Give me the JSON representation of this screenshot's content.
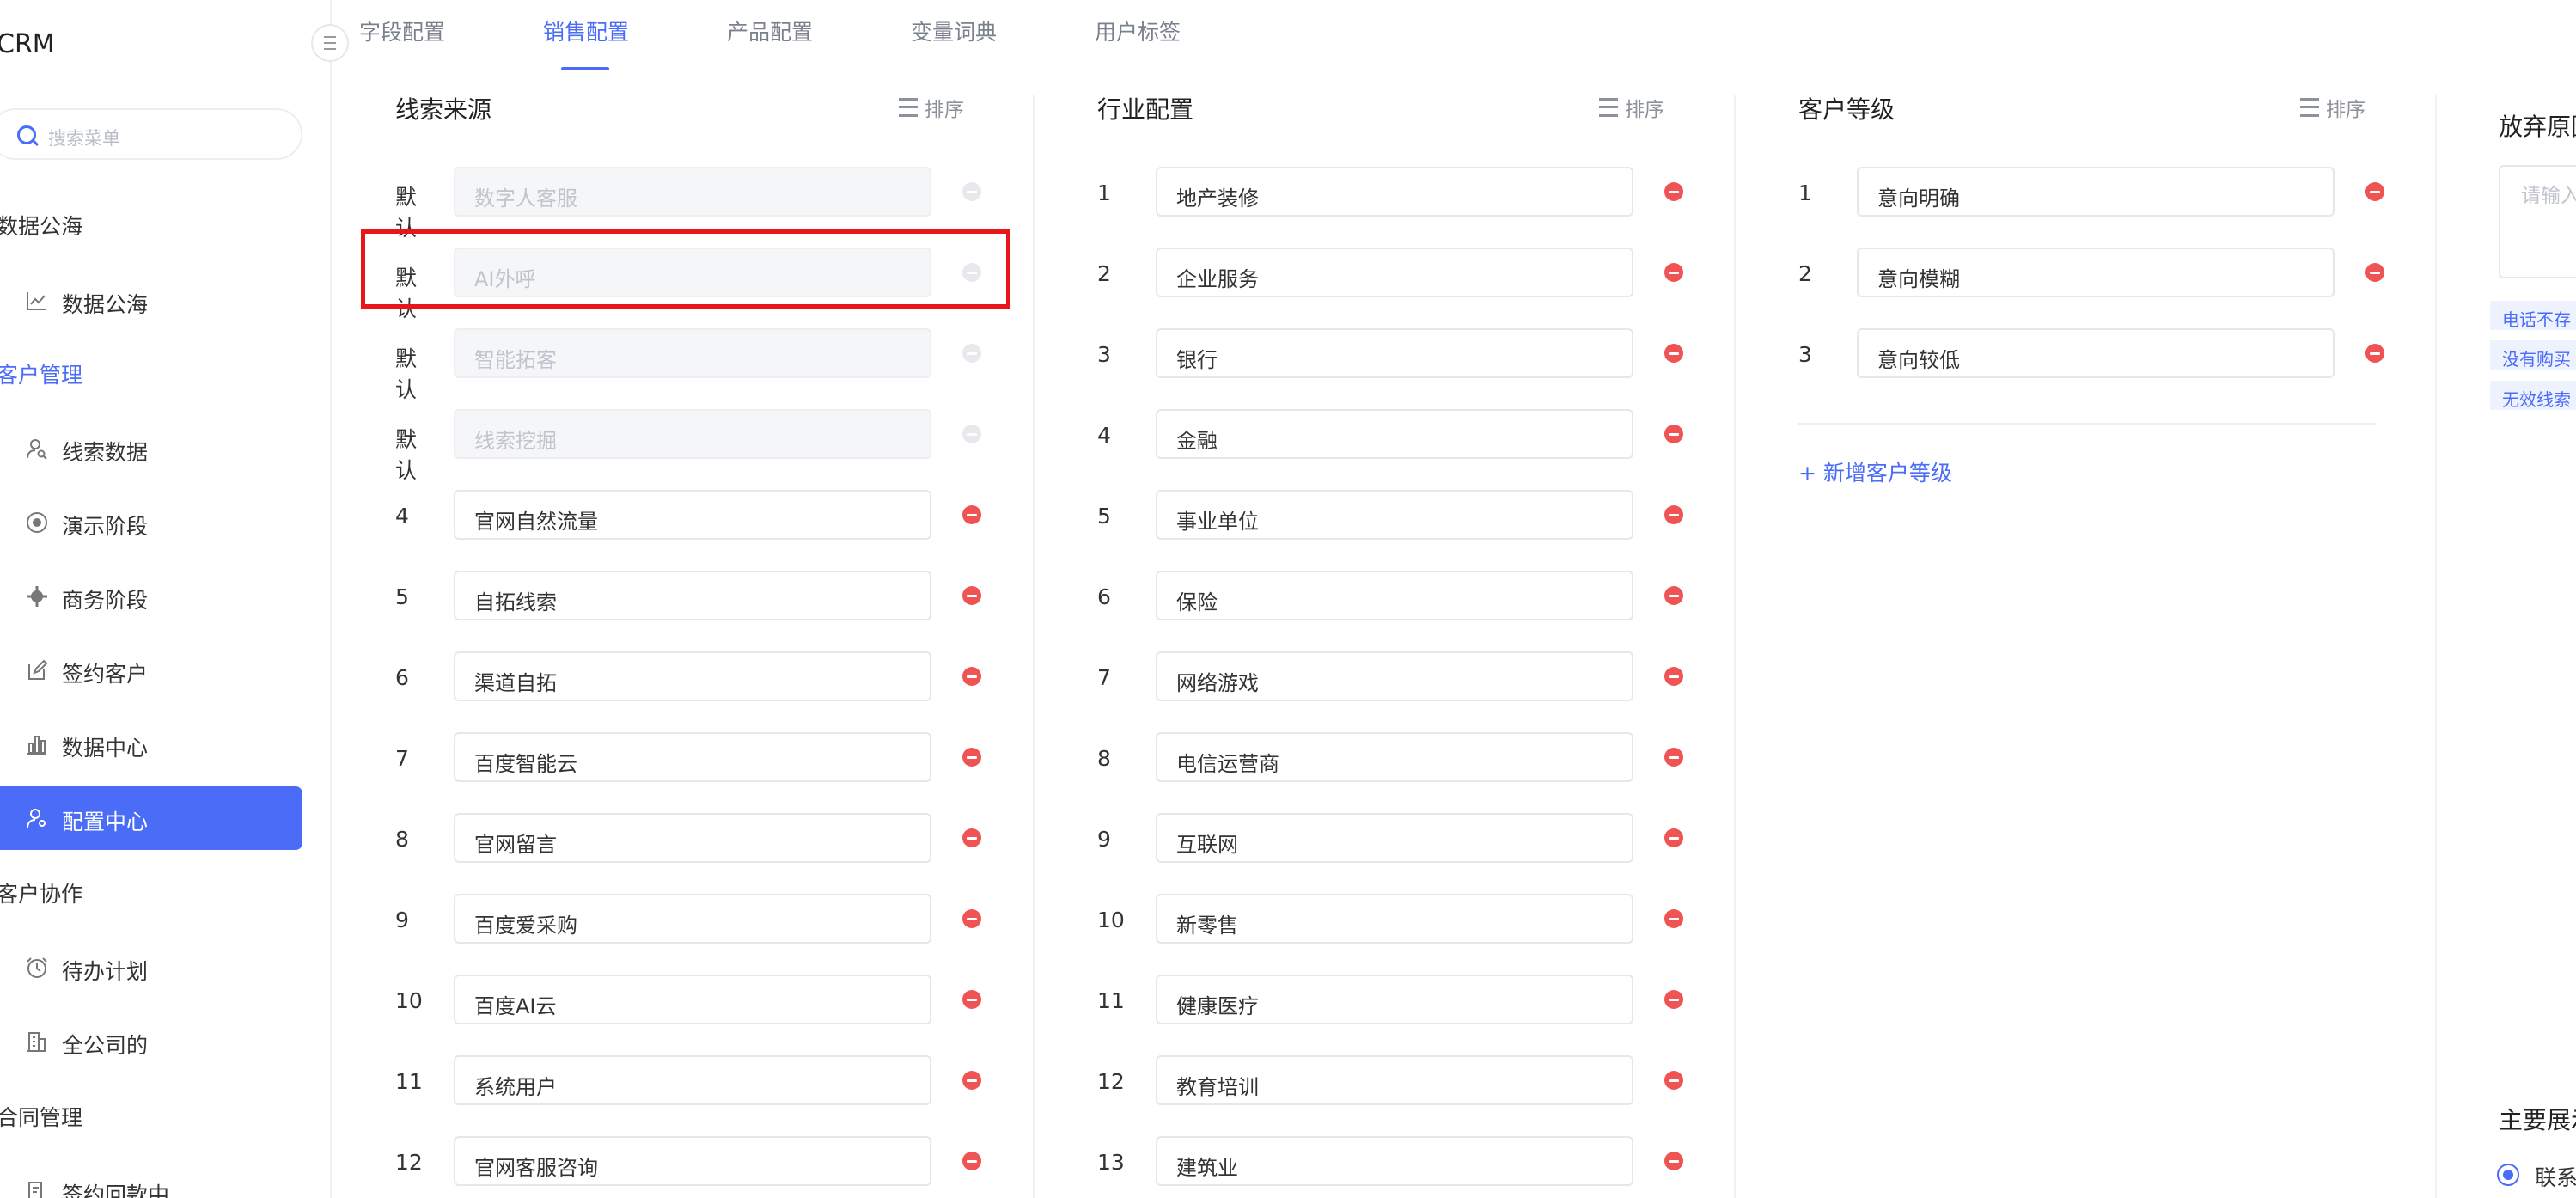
{
  "app": {
    "title": "CRM"
  },
  "sidebar": {
    "search_placeholder": "搜索菜单",
    "groups": [
      {
        "label": "数据公海"
      },
      {
        "label": "客户管理"
      },
      {
        "label": "客户协作"
      },
      {
        "label": "合同管理"
      }
    ],
    "items": [
      {
        "label": "数据公海",
        "icon": "chart-line-icon"
      },
      {
        "label": "线索数据",
        "icon": "user-search-icon"
      },
      {
        "label": "演示阶段",
        "icon": "target-icon"
      },
      {
        "label": "商务阶段",
        "icon": "gear-icon"
      },
      {
        "label": "签约客户",
        "icon": "edit-icon"
      },
      {
        "label": "数据中心",
        "icon": "bar-chart-icon"
      },
      {
        "label": "配置中心",
        "icon": "user-settings-icon"
      },
      {
        "label": "待办计划",
        "icon": "alarm-clock-icon"
      },
      {
        "label": "全公司的",
        "icon": "building-icon"
      },
      {
        "label": "签约回款中",
        "icon": "contract-icon"
      }
    ],
    "active_item": "配置中心",
    "active_group": "客户管理"
  },
  "tabs": [
    {
      "label": "字段配置"
    },
    {
      "label": "销售配置"
    },
    {
      "label": "产品配置"
    },
    {
      "label": "变量词典"
    },
    {
      "label": "用户标签"
    }
  ],
  "active_tab": "销售配置",
  "sort_label": "排序",
  "lead_source": {
    "title": "线索来源",
    "rows": [
      {
        "index": "默认",
        "value": "数字人客服",
        "default": true
      },
      {
        "index": "默认",
        "value": "AI外呼",
        "default": true
      },
      {
        "index": "默认",
        "value": "智能拓客",
        "default": true
      },
      {
        "index": "默认",
        "value": "线索挖掘",
        "default": true
      },
      {
        "index": "4",
        "value": "官网自然流量"
      },
      {
        "index": "5",
        "value": "自拓线索"
      },
      {
        "index": "6",
        "value": "渠道自拓"
      },
      {
        "index": "7",
        "value": "百度智能云"
      },
      {
        "index": "8",
        "value": "官网留言"
      },
      {
        "index": "9",
        "value": "百度爱采购"
      },
      {
        "index": "10",
        "value": "百度AI云"
      },
      {
        "index": "11",
        "value": "系统用户"
      },
      {
        "index": "12",
        "value": "官网客服咨询"
      }
    ]
  },
  "industry": {
    "title": "行业配置",
    "rows": [
      {
        "index": "1",
        "value": "地产装修"
      },
      {
        "index": "2",
        "value": "企业服务"
      },
      {
        "index": "3",
        "value": "银行"
      },
      {
        "index": "4",
        "value": "金融"
      },
      {
        "index": "5",
        "value": "事业单位"
      },
      {
        "index": "6",
        "value": "保险"
      },
      {
        "index": "7",
        "value": "网络游戏"
      },
      {
        "index": "8",
        "value": "电信运营商"
      },
      {
        "index": "9",
        "value": "互联网"
      },
      {
        "index": "10",
        "value": "新零售"
      },
      {
        "index": "11",
        "value": "健康医疗"
      },
      {
        "index": "12",
        "value": "教育培训"
      },
      {
        "index": "13",
        "value": "建筑业"
      }
    ]
  },
  "customer_level": {
    "title": "客户等级",
    "rows": [
      {
        "index": "1",
        "value": "意向明确"
      },
      {
        "index": "2",
        "value": "意向模糊"
      },
      {
        "index": "3",
        "value": "意向较低"
      }
    ],
    "add_label": "+ 新增客户等级"
  },
  "abandon_reason": {
    "title": "放弃原因",
    "placeholder": "请输入",
    "tags": [
      "电话不存",
      "没有购买",
      "无效线索"
    ]
  },
  "main_display": {
    "title": "主要展示",
    "option": "联系"
  },
  "colors": {
    "accent": "#4a6cf7",
    "delete": "#f05353",
    "highlight": "#e8151b"
  }
}
